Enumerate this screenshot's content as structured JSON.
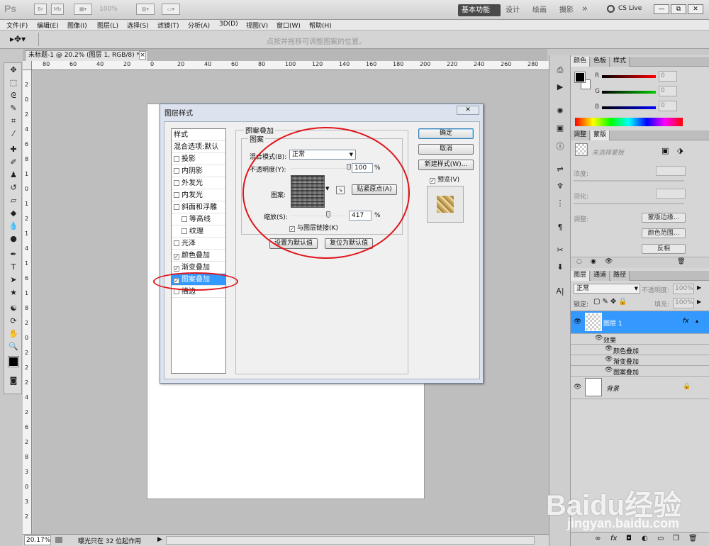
{
  "app": {
    "logo": "Ps",
    "zoom": "100%",
    "workspaces": [
      "基本功能",
      "设计",
      "绘画",
      "摄影"
    ],
    "more": "»",
    "cs_live": "CS Live",
    "window_buttons": [
      "—",
      "⧉",
      "✕"
    ]
  },
  "menu": [
    "文件(F)",
    "编辑(E)",
    "图像(I)",
    "图层(L)",
    "选择(S)",
    "滤镜(T)",
    "分析(A)",
    "3D(D)",
    "视图(V)",
    "窗口(W)",
    "帮助(H)"
  ],
  "options_bar": {
    "hint": "点按并拖移可调整图案的位置。"
  },
  "document": {
    "tab_title": "未标题-1 @ 20.2% (图层 1, RGB/8) *",
    "tab_close": "×",
    "ruler_h": [
      "80",
      "60",
      "40",
      "20",
      "0",
      "20",
      "40",
      "60",
      "80",
      "100",
      "120",
      "140",
      "160",
      "180",
      "200",
      "220",
      "240",
      "260",
      "280"
    ],
    "ruler_v": [
      "2",
      "0",
      "2",
      "4",
      "6",
      "8",
      "1",
      "0",
      "1",
      "2",
      "1",
      "4",
      "1",
      "6",
      "1",
      "8",
      "2",
      "0",
      "2",
      "2",
      "2",
      "4",
      "2",
      "6",
      "2",
      "8",
      "3",
      "0",
      "3",
      "2"
    ]
  },
  "status": {
    "zoom": "20.17%",
    "message": "曝光只在 32 位起作用"
  },
  "dialog": {
    "title": "图层样式",
    "close": "✕",
    "styles_header": "样式",
    "blend_options": "混合选项:默认",
    "styles": [
      {
        "label": "投影",
        "checked": false,
        "indent": false
      },
      {
        "label": "内阴影",
        "checked": false,
        "indent": false
      },
      {
        "label": "外发光",
        "checked": false,
        "indent": false
      },
      {
        "label": "内发光",
        "checked": false,
        "indent": false
      },
      {
        "label": "斜面和浮雕",
        "checked": false,
        "indent": false
      },
      {
        "label": "等高线",
        "checked": false,
        "indent": true
      },
      {
        "label": "纹理",
        "checked": false,
        "indent": true
      },
      {
        "label": "光泽",
        "checked": false,
        "indent": false
      },
      {
        "label": "颜色叠加",
        "checked": true,
        "indent": false
      },
      {
        "label": "渐变叠加",
        "checked": true,
        "indent": false
      },
      {
        "label": "图案叠加",
        "checked": true,
        "indent": false,
        "selected": true
      },
      {
        "label": "描边",
        "checked": false,
        "indent": false
      }
    ],
    "section_title": "图案叠加",
    "group_title": "图案",
    "blend_mode_label": "混合模式(B):",
    "blend_mode_value": "正常",
    "opacity_label": "不透明度(Y):",
    "opacity_value": "100",
    "opacity_level": 1.0,
    "percent": "%",
    "pattern_label": "图案:",
    "snap_origin": "贴紧原点(A)",
    "scale_label": "缩放(S):",
    "scale_value": "417",
    "scale_level": 0.417,
    "link_label": "与图层链接(K)",
    "set_default": "设置为默认值",
    "reset_default": "复位为默认值",
    "ok": "确定",
    "cancel": "取消",
    "new_style": "新建样式(W)...",
    "preview": "预览(V)",
    "check": "✓"
  },
  "panels": {
    "color_tabs": [
      "颜色",
      "色板",
      "样式"
    ],
    "color": {
      "r_label": "R",
      "g_label": "G",
      "b_label": "B",
      "r": "0",
      "g": "0",
      "b": "0"
    },
    "adjust_tabs": [
      "调整",
      "蒙版"
    ],
    "mask": {
      "no_selection": "未选择蒙版",
      "density_label": "浓度:",
      "feather_label": "羽化:",
      "refine_label": "调整:",
      "mask_edge": "蒙版边缘...",
      "color_range": "颜色范围...",
      "invert": "反相"
    },
    "layers_tabs": [
      "图层",
      "通道",
      "路径"
    ],
    "layers": {
      "blend_mode": "正常",
      "opacity_label": "不透明度:",
      "opacity": "100%",
      "lock_label": "锁定:",
      "fill_label": "填充:",
      "fill": "100%",
      "layer1": "图层 1",
      "fx": "fx",
      "effects": "效果",
      "effect_items": [
        "颜色叠加",
        "渐变叠加",
        "图案叠加"
      ],
      "background": "背景"
    },
    "footer_icons": [
      "∞",
      "fx",
      "◘",
      "◐",
      "▭",
      "❒",
      "🗑"
    ]
  },
  "colors": {
    "accent": "#3399ff",
    "ring": "#e0151b",
    "active_ws": "#4a4a4a"
  }
}
